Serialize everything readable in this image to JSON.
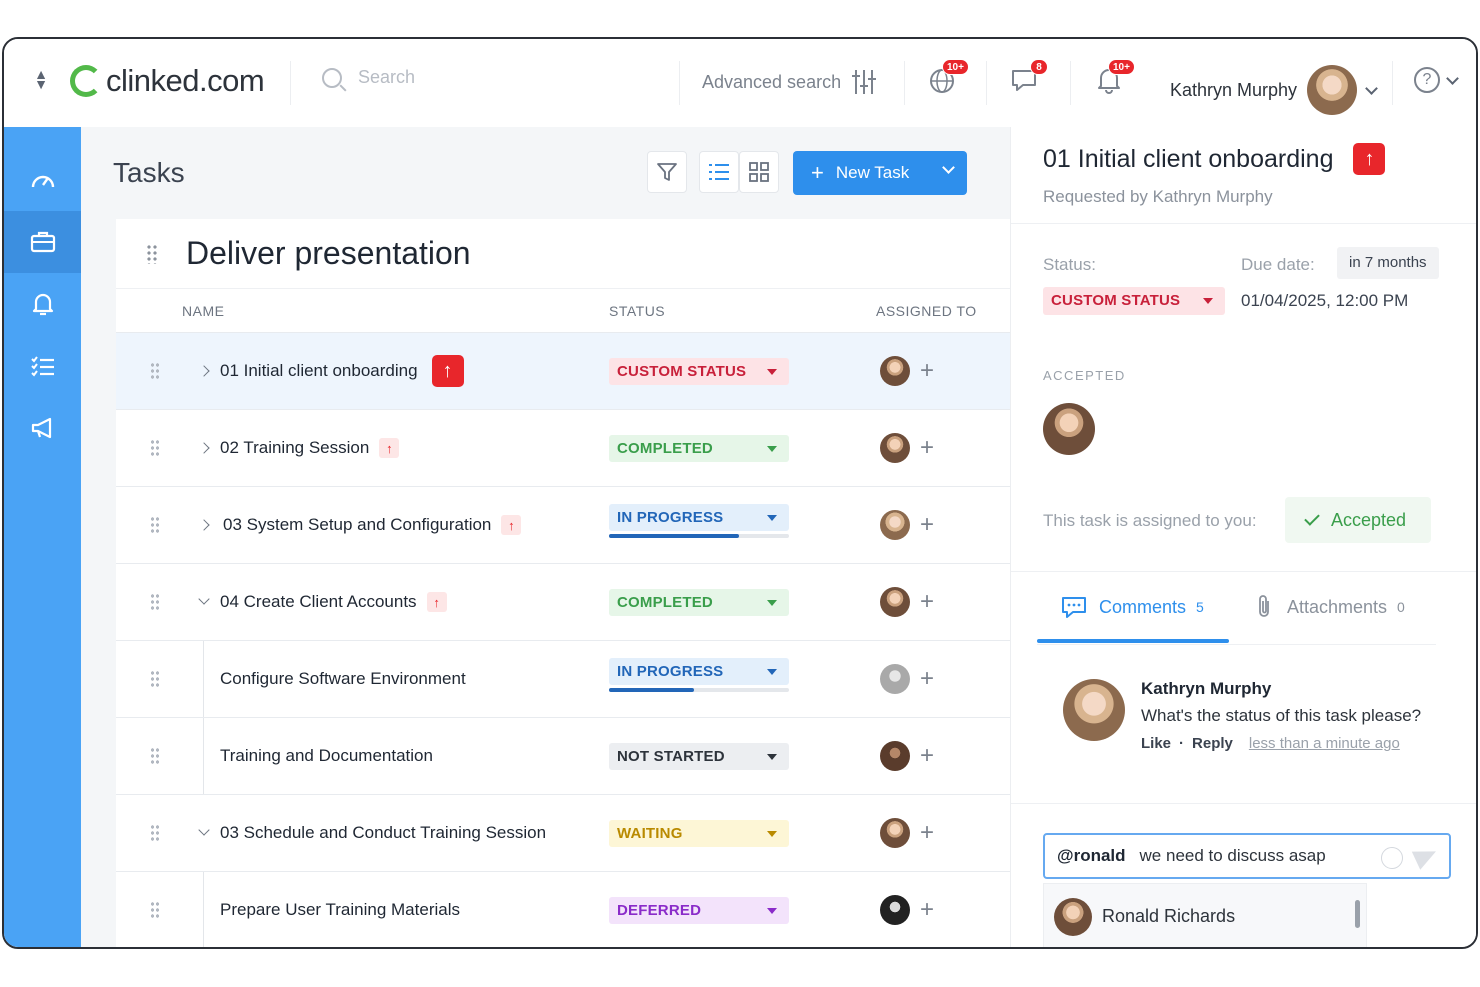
{
  "app": {
    "logo_text": "clinked.com",
    "brand_color": "#52b949",
    "accent": "#2e8fec"
  },
  "header": {
    "search_placeholder": "Search",
    "advanced_search": "Advanced search",
    "globe_badge": "10+",
    "chat_badge": "8",
    "bell_badge": "10+",
    "user_name": "Kathryn Murphy",
    "help": "?"
  },
  "sidebar": {
    "items": [
      "dashboard-icon",
      "briefcase-icon",
      "bell-icon",
      "checklist-icon",
      "megaphone-icon"
    ],
    "active": 1
  },
  "tasks": {
    "title": "Tasks",
    "new_task": "New Task",
    "board_title": "Deliver presentation",
    "columns": {
      "name": "NAME",
      "status": "STATUS",
      "assigned": "ASSIGNED TO"
    },
    "rows": [
      {
        "name": "01 Initial client onboarding",
        "status": "CUSTOM STATUS",
        "status_bg": "#fde3e6",
        "status_fg": "#c8203a",
        "progress": null
      },
      {
        "name": "02 Training Session",
        "status": "COMPLETED",
        "status_bg": "#e6f6e8",
        "status_fg": "#3a9e4b",
        "progress": null
      },
      {
        "name": "03 System Setup and Configuration",
        "status": "IN PROGRESS",
        "status_bg": "#e3effb",
        "status_fg": "#2266b8",
        "progress": 0.72
      },
      {
        "name": "04 Create Client Accounts",
        "status": "COMPLETED",
        "status_bg": "#e6f6e8",
        "status_fg": "#3a9e4b",
        "progress": null
      },
      {
        "name": "Configure Software Environment",
        "status": "IN PROGRESS",
        "status_bg": "#e3effb",
        "status_fg": "#2266b8",
        "progress": 0.47
      },
      {
        "name": "Training and Documentation",
        "status": "NOT STARTED",
        "status_bg": "#eceef1",
        "status_fg": "#2d333b",
        "progress": null
      },
      {
        "name": "03 Schedule and Conduct Training Session",
        "status": "WAITING",
        "status_bg": "#fdf6d6",
        "status_fg": "#b98a00",
        "progress": null
      },
      {
        "name": "Prepare User Training Materials",
        "status": "DEFERRED",
        "status_bg": "#f3e3fb",
        "status_fg": "#8a2bc9",
        "progress": null
      }
    ]
  },
  "detail": {
    "title": "01 Initial client onboarding",
    "requested_by": "Requested by Kathryn Murphy",
    "status_label": "Status:",
    "due_label": "Due date:",
    "due_relative": "in 7 months",
    "status_value": "CUSTOM STATUS",
    "due_value": "01/04/2025, 12:00 PM",
    "accepted_label": "ACCEPTED",
    "assigned_text": "This task is assigned to you:",
    "accepted_button": "Accepted",
    "tabs": {
      "comments": "Comments",
      "comments_count": "5",
      "attachments": "Attachments",
      "attachments_count": "0"
    },
    "comment": {
      "author": "Kathryn Murphy",
      "text": "What's the status of this task please?",
      "like": "Like",
      "reply": "Reply",
      "time": "less than a minute ago"
    },
    "input": {
      "mention": "@ronald",
      "text": "we need to discuss asap"
    },
    "suggestion": "Ronald Richards"
  }
}
